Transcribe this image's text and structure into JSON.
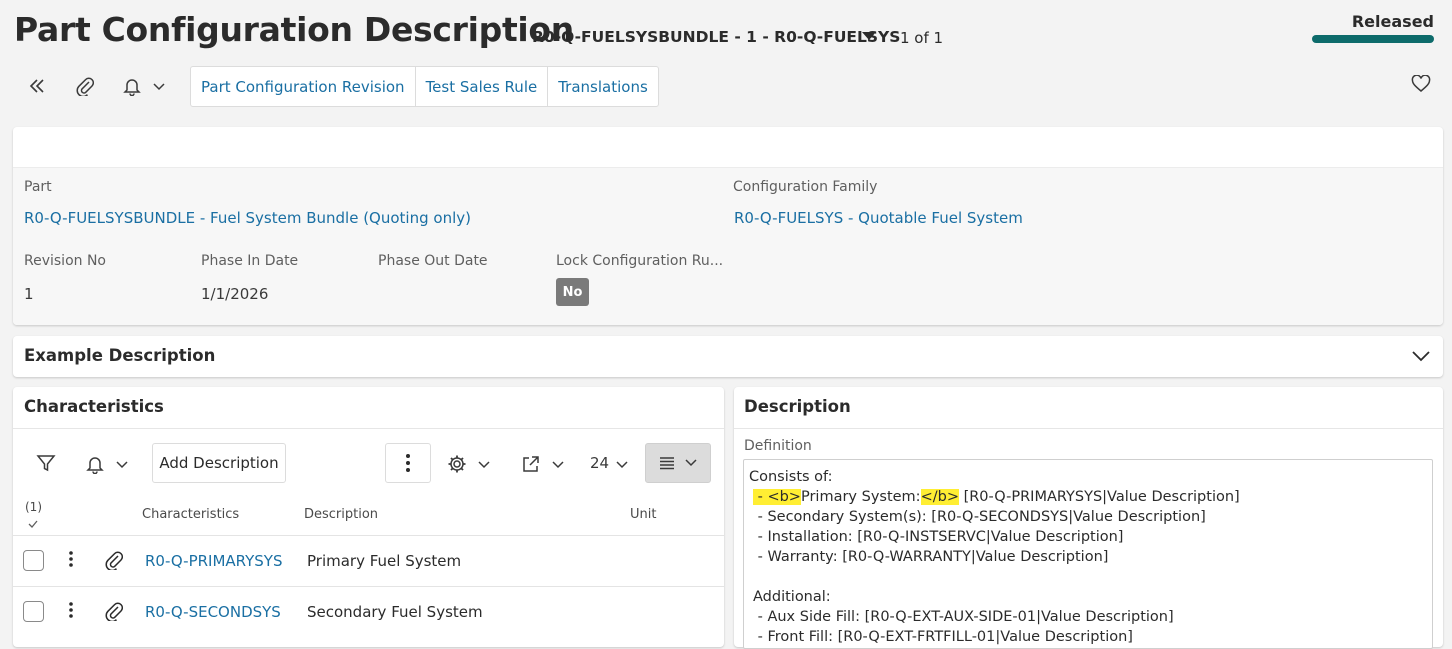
{
  "header": {
    "title": "Part Configuration Description",
    "record_key": "R0-Q-FUELSYSBUNDLE - 1 - R0-Q-FUELSYS",
    "record_count": "1 of 1",
    "status": "Released",
    "status_color": "#0d6b6b"
  },
  "toolbar": {
    "tabs": [
      {
        "label": "Part Configuration Revision"
      },
      {
        "label": "Test Sales Rule"
      },
      {
        "label": "Translations"
      }
    ]
  },
  "details": {
    "part_label": "Part",
    "part_value": "R0-Q-FUELSYSBUNDLE - Fuel System Bundle (Quoting only)",
    "family_label": "Configuration Family",
    "family_value": "R0-Q-FUELSYS - Quotable Fuel System",
    "revision_label": "Revision No",
    "revision_value": "1",
    "phase_in_label": "Phase In Date",
    "phase_in_value": "1/1/2026",
    "phase_out_label": "Phase Out Date",
    "lock_label": "Lock Configuration Ru...",
    "lock_value": "No"
  },
  "example": {
    "title": "Example Description"
  },
  "characteristics": {
    "title": "Characteristics",
    "add_label": "Add Description",
    "page_size": "24",
    "selected_count": "(1)",
    "columns": [
      "Characteristics",
      "Description",
      "Unit"
    ],
    "rows": [
      {
        "characteristic": "R0-Q-PRIMARYSYS",
        "description": "Primary Fuel System"
      },
      {
        "characteristic": "R0-Q-SECONDSYS",
        "description": "Secondary Fuel System"
      }
    ]
  },
  "description": {
    "title": "Description",
    "definition_label": "Definition",
    "line1": "Consists of:",
    "line2_a": " - ",
    "line2_b": "<b>",
    "line2_c": "Primary System:",
    "line2_d": "</b>",
    "line2_e": " [R0-Q-PRIMARYSYS|Value Description]",
    "line3": " - Secondary System(s): [R0-Q-SECONDSYS|Value Description]",
    "line4": " - Installation: [R0-Q-INSTSERVC|Value Description]",
    "line5": " - Warranty: [R0-Q-WARRANTY|Value Description]",
    "line7": "Additional:",
    "line8": " - Aux Side Fill: [R0-Q-EXT-AUX-SIDE-01|Value Description]",
    "line9": " - Front Fill: [R0-Q-EXT-FRTFILL-01|Value Description]",
    "highlight_color": "#ffee33"
  }
}
